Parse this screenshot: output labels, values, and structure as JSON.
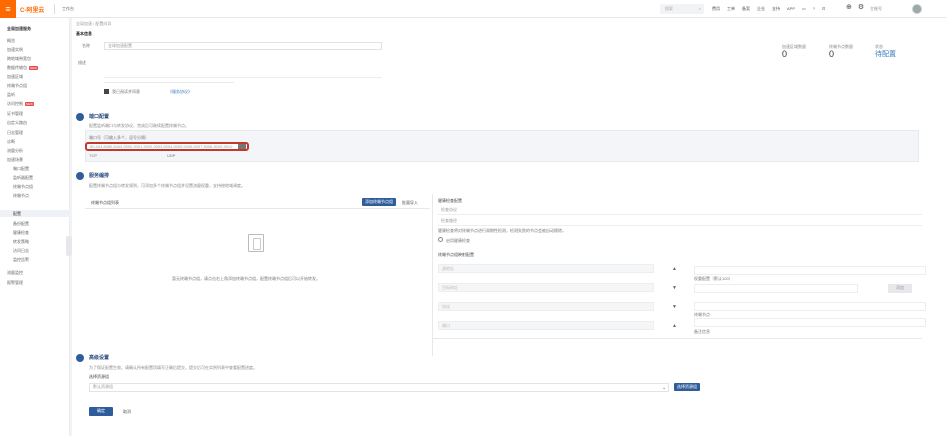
{
  "topbar": {
    "menu_icon": "menu-icon",
    "logo": "C-阿里云",
    "home": "工作台",
    "search_placeholder": "搜索",
    "nav": [
      "费用",
      "工单",
      "备案",
      "企业",
      "支持",
      "APP"
    ],
    "icons": [
      "message-icon",
      "help-icon",
      "cart-icon",
      "language-icon",
      "settings-icon"
    ],
    "user": "主账号"
  },
  "sidebar": {
    "title": "全局加速服务",
    "items": [
      {
        "label": "概览"
      },
      {
        "label": "加速实例"
      },
      {
        "label": "跨地域带宽包"
      },
      {
        "label": "数据传输包",
        "badge": "NEW"
      },
      {
        "label": "加速区域"
      },
      {
        "label": "终端节点组"
      },
      {
        "label": "监听"
      },
      {
        "label": "访问控制",
        "badge": "NEW"
      },
      {
        "label": "证书管理"
      },
      {
        "label": "自定义路由"
      },
      {
        "label": "日志管理"
      },
      {
        "label": "诊断"
      },
      {
        "label": "流量分析"
      },
      {
        "label": "加速场景"
      }
    ],
    "subitems": [
      "端口配置",
      "监听器配置",
      "终端节点组",
      "终端节点",
      "配置"
    ],
    "subitems2": [
      "备份配置",
      "健康检查",
      "转发策略",
      "访问日志",
      "监控告警"
    ],
    "bottom_items": [
      "流量监控",
      "报警管理"
    ]
  },
  "content": {
    "breadcrumb": "全局加速 / 配置向导",
    "basic_title": "基本信息",
    "name_label": "名称",
    "name_value": "全球加速配置",
    "desc_label": "描述",
    "checkbox_label": "我已阅读并同意",
    "checkbox_link": "《服务协议》",
    "stats": [
      {
        "label": "加速区域数量",
        "value": "0"
      },
      {
        "label": "终端节点数量",
        "value": "0"
      },
      {
        "label": "状态",
        "value": "待配置"
      }
    ],
    "step1": {
      "title": "端口配置",
      "desc": "配置监听端口与转发协议，完成后可继续配置终端节点。",
      "input_label": "端口号（可输入多个，逗号分隔）",
      "input_value": "80,443,8080,8443,9000,9001,9002,9003,9004,9005,9006,9007,9008,9009,9010",
      "under_labels": [
        "TCP",
        "UDP"
      ],
      "edit_icon": "edit-icon"
    },
    "step2": {
      "title": "服务编排",
      "desc": "配置终端节点组与转发规则，可添加多个终端节点组并设置流量权重，支持按地域调度。",
      "left_header": "终端节点组列表",
      "add_button": "添加终端节点组",
      "import_button": "批量导入",
      "empty_icon": "document-icon",
      "empty_text": "暂无终端节点组，请点击右上角添加终端节点组，配置终端节点组后可以开始转发。",
      "right_title": "健康检查配置",
      "right_field1": "检查协议",
      "right_field2": "检查路径",
      "right_note": "健康检查将对终端节点进行周期性检测，检测失败的节点会被自动剔除。",
      "radio_label": "启用健康检查",
      "mapping_title": "终端节点组映射配置",
      "rows": [
        "源地址",
        "目标地址",
        "协议",
        "端口"
      ],
      "right_col_labels": [
        "权重配置（默认100）",
        "终端节点",
        "备注信息"
      ],
      "right_col_btn": "添加"
    },
    "step3": {
      "title": "高级设置",
      "desc": "为了保证配置生效，请确认所有配置项填写正确后提交，提交后可在实例列表中查看配置进度。",
      "select_label": "选择资源组",
      "select_placeholder": "默认资源组",
      "select_btn": "选择资源组"
    },
    "submit": "确定",
    "cancel": "取消"
  }
}
